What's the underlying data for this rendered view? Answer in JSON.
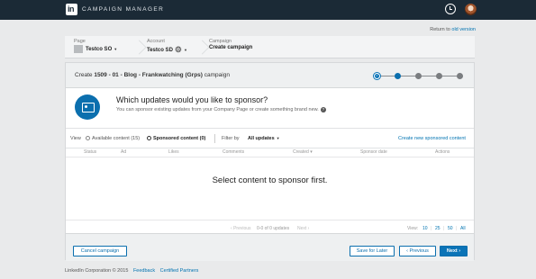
{
  "topbar": {
    "logo_text": "in",
    "brand": "CAMPAIGN MANAGER",
    "clock_icon": "clock-icon",
    "avatar_icon": "user-avatar"
  },
  "return": {
    "prefix": "Return to",
    "link": "old version"
  },
  "breadcrumb": {
    "page_label": "Page",
    "page_value": "Testco SO",
    "account_label": "Account",
    "account_value": "Testco SD",
    "campaign_label": "Campaign",
    "campaign_value": "Create campaign"
  },
  "header": {
    "create_prefix": "Create",
    "campaign_name": "1509 - 01 - Blog - Frankwatching (Grps)",
    "campaign_suffix": "campaign",
    "steps_total": 5,
    "steps_current": 2
  },
  "sponsor": {
    "title": "Which updates would you like to sponsor?",
    "subtitle": "You can sponsor existing updates from your Company Page or create something brand new.",
    "help": "?"
  },
  "filters": {
    "view_label": "View",
    "available": "Available content (15)",
    "sponsored": "Sponsored content (0)",
    "filter_label": "Filter by",
    "filter_value": "All updates",
    "create_link": "Create new sponsored content"
  },
  "table": {
    "columns": [
      "Status",
      "Ad",
      "Likes",
      "Comments",
      "Created",
      "Sponsor date",
      "Actions"
    ]
  },
  "empty_message": "Select content to sponsor first.",
  "pager": {
    "previous": "Previous",
    "range": "0-0 of 0 updates",
    "next": "Next",
    "view_label": "View:",
    "sizes": [
      "10",
      "25",
      "50",
      "All"
    ]
  },
  "buttons": {
    "cancel": "Cancel campaign",
    "save": "Save for Later",
    "previous": "Previous",
    "next": "Next"
  },
  "footer": {
    "copyright": "LinkedIn Corporation © 2015",
    "feedback": "Feedback",
    "partners": "Certified Partners"
  },
  "colors": {
    "accent": "#0b74b7",
    "topbar": "#1b2a36",
    "background": "#e9eaeb"
  }
}
